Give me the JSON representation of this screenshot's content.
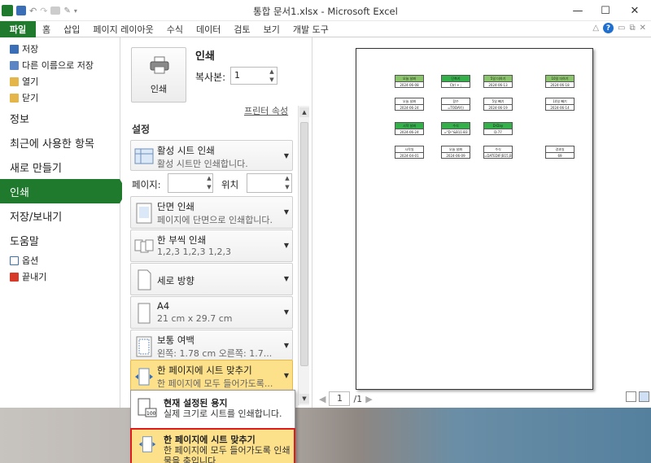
{
  "window": {
    "title": "통합 문서1.xlsx - Microsoft Excel",
    "minimize": "—",
    "maximize": "☐",
    "close": "✕"
  },
  "ribbon": {
    "file_tab": "파일",
    "tabs": [
      "홈",
      "삽입",
      "페이지 레이아웃",
      "수식",
      "데이터",
      "검토",
      "보기",
      "개발 도구"
    ]
  },
  "nav": {
    "items_top": [
      {
        "label": "저장",
        "icon": "save-icon"
      },
      {
        "label": "다른 이름으로 저장",
        "icon": "save-as-icon"
      },
      {
        "label": "열기",
        "icon": "open-folder-icon"
      },
      {
        "label": "닫기",
        "icon": "close-folder-icon"
      }
    ],
    "items_big": [
      "정보",
      "최근에 사용한 항목",
      "새로 만들기",
      "인쇄",
      "저장/보내기",
      "도움말"
    ],
    "active": "인쇄",
    "items_bottom": [
      {
        "label": "옵션",
        "icon": "options-icon"
      },
      {
        "label": "끝내기",
        "icon": "exit-icon"
      }
    ]
  },
  "print": {
    "heading": "인쇄",
    "button_label": "인쇄",
    "copies_label": "복사본:",
    "copies_value": "1",
    "printer_properties": "프린터 속성",
    "settings_heading": "설정",
    "page_label": "페이지:",
    "to_label": "위치",
    "dropdowns": [
      {
        "title": "활성 시트 인쇄",
        "sub": "활성 시트만 인쇄합니다."
      },
      {
        "title": "단면 인쇄",
        "sub": "페이지에 단면으로 인쇄합니다."
      },
      {
        "title": "한 부씩 인쇄",
        "sub": "1,2,3    1,2,3    1,2,3"
      },
      {
        "title": "세로 방향",
        "sub": ""
      },
      {
        "title": "A4",
        "sub": "21 cm x 29.7 cm"
      },
      {
        "title": "보통 여백",
        "sub": "왼쪽:   1.78 cm    오른쪽:   1.7..."
      },
      {
        "title": "한 페이지에 시트 맞추기",
        "sub": "한 페이지에 모두 들어가도록..."
      }
    ]
  },
  "popup": {
    "items": [
      {
        "title": "현재 설정된 용지",
        "sub": "실제 크기로 시트를 인쇄합니다."
      },
      {
        "title": "한 페이지에 시트 맞추기",
        "sub": "한 페이지에 모두 들어가도록 인쇄물을 축입니다"
      }
    ]
  },
  "preview": {
    "page_current": "1",
    "page_total": "/1",
    "cells": [
      {
        "h": "오늘 날짜",
        "v": "2024-06-08",
        "style": "g"
      },
      {
        "h": "단축키",
        "v": "Ctrl + ;",
        "style": "dg"
      },
      {
        "h": "5일 더하기",
        "v": "2024-06-13",
        "style": "g"
      },
      {
        "h": "10일 더하기",
        "v": "2024-06-18",
        "style": "g"
      },
      {
        "h": "오늘 날짜",
        "v": "2024-06-24",
        "style": ""
      },
      {
        "h": "함수",
        "v": "=TODAY()",
        "style": ""
      },
      {
        "h": "5일 빼기",
        "v": "2024-06-19",
        "style": ""
      },
      {
        "h": "10일 빼기",
        "v": "2024-06-14",
        "style": ""
      },
      {
        "h": "시작 날짜",
        "v": "2024-06-24",
        "style": "dg"
      },
      {
        "h": "수식",
        "v": "=\"D-\"&B11-B3",
        "style": "dg"
      },
      {
        "h": "D-Day",
        "v": "D-77",
        "style": "dg"
      },
      {
        "h": "시작일",
        "v": "2024-04-01",
        "style": ""
      },
      {
        "h": "오늘 날짜",
        "v": "2024-06-09",
        "style": ""
      },
      {
        "h": "수식",
        "v": "=DATEDIF(B15,B16,\"D\")",
        "style": ""
      },
      {
        "h": "경과일",
        "v": "69",
        "style": ""
      }
    ]
  },
  "colors": {
    "accent": "#1f7a2e",
    "highlight": "#fde08a",
    "selection_border": "#e01b1b"
  }
}
